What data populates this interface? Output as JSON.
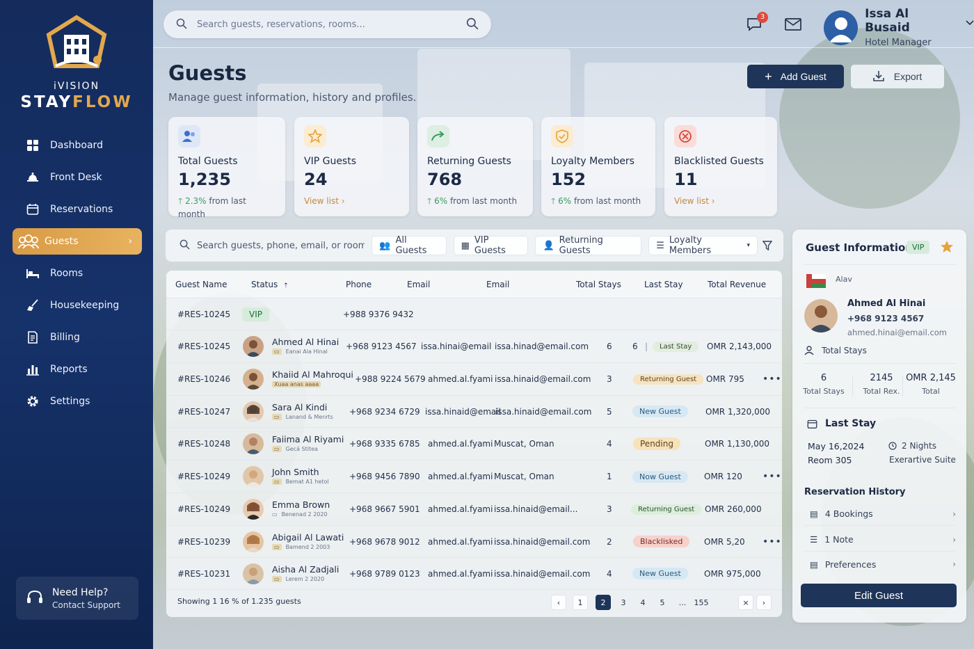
{
  "brand": {
    "line1": "iVISION",
    "line2a": "STAY",
    "line2b": "FLOW"
  },
  "sidebar": {
    "items": [
      {
        "label": "Dashboard",
        "icon": "grid-icon"
      },
      {
        "label": "Front Desk",
        "icon": "bell-icon"
      },
      {
        "label": "Reservations",
        "icon": "calendar-icon"
      },
      {
        "label": "Guests",
        "icon": "users-icon",
        "active": true
      },
      {
        "label": "Rooms",
        "icon": "bed-icon"
      },
      {
        "label": "Housekeeping",
        "icon": "broom-icon"
      },
      {
        "label": "Billing",
        "icon": "invoice-icon"
      },
      {
        "label": "Reports",
        "icon": "bar-chart-icon"
      },
      {
        "label": "Settings",
        "icon": "gear-icon"
      }
    ],
    "help_title": "Need Help?",
    "help_sub": "Contact Support"
  },
  "topbar": {
    "search_placeholder": "Search guests, reservations, rooms...",
    "notif_count": "3",
    "user_name": "Issa Al Busaid",
    "user_role": "Hotel Manager"
  },
  "page": {
    "title": "Guests",
    "subtitle": "Manage guest information, history and profiles.",
    "add_label": "Add Guest",
    "export_label": "Export"
  },
  "cards": [
    {
      "label": "Total Guests",
      "value": "1,235",
      "change": "2.3%",
      "change_text": "from last month",
      "color": "#3b6fd1"
    },
    {
      "label": "VIP Guests",
      "value": "24",
      "link": "View list",
      "color": "#e6a23c"
    },
    {
      "label": "Returning Guests",
      "value": "768",
      "change": "6%",
      "change_text": "from last month",
      "color": "#3a9b5b"
    },
    {
      "label": "Loyalty Members",
      "value": "152",
      "change": "6%",
      "change_text": "from last month",
      "color": "#e6a23c"
    },
    {
      "label": "Blacklisted Guests",
      "value": "11",
      "link": "View list",
      "color": "#d9463a"
    }
  ],
  "filters": {
    "search_placeholder": "Search guests, phone, email, or room #...",
    "chips": [
      "All Guests",
      "VIP Guests",
      "Returning Guests",
      "Loyalty Members"
    ]
  },
  "table": {
    "headers": [
      "Guest Name",
      "Status",
      "Phone",
      "Email",
      "Email",
      "Total Stays",
      "Last Stay",
      "Total Revenue"
    ],
    "rows": [
      {
        "id": "#RES-10245",
        "status": "VIP",
        "phone": "+988 9376 9432"
      },
      {
        "id": "#RES-10245",
        "name": "Ahmed Al Hinai",
        "sub": "Eanai Ala Hinal",
        "phone": "+968 9123 4567",
        "email1": "issa.hinai@email",
        "email2": "issa.hinad@email.com",
        "stays": "6",
        "stays2": "6",
        "status": "Last Stay",
        "revenue": "OMR 2,143,000"
      },
      {
        "id": "#RES-10246",
        "name": "Khaiid Al Mahroqui",
        "sub": "Xuaa anas aaaa",
        "phone": "+988 9224 5679",
        "email1": "ahmed.al.fyami",
        "email2": "issa.hinaid@email.com",
        "stays": "3",
        "status": "Returning Guest",
        "revenue": "OMR 795"
      },
      {
        "id": "#RES-10247",
        "name": "Sara Al Kindi",
        "sub": "Lanand & Menrts",
        "phone": "+968 9234 6729",
        "email1": "issa.hinaid@email",
        "email2": "issa.hinaid@email.com",
        "stays": "5",
        "status": "New Guest",
        "revenue": "OMR 1,320,000"
      },
      {
        "id": "#RES-10248",
        "name": "Faiima Al Riyami",
        "sub": "Gecá Stitea",
        "phone": "+968 9335 6785",
        "email1": "ahmed.al.fyami",
        "email2": "Muscat, Oman",
        "stays": "4",
        "status": "Pending",
        "revenue": "OMR 1,130,000"
      },
      {
        "id": "#RES-10249",
        "name": "John Smith",
        "sub": "Bemat A1 hetol",
        "phone": "+968 9456 7890",
        "email1": "ahmed.al.fyami",
        "email2": "Muscat, Oman",
        "stays": "1",
        "status": "Now Guest",
        "revenue": "OMR 120"
      },
      {
        "id": "#RES-10249",
        "name": "Emma Brown",
        "sub": "Benenad 2 2020",
        "phone": "+968 9667 5901",
        "email1": "ahmed.al.fyami",
        "email2": "issa.hinaid@email...",
        "stays": "3",
        "status": "Returning Guest",
        "revenue": "OMR 260,000"
      },
      {
        "id": "#RES-10239",
        "name": "Abigail Al Lawati",
        "sub": "Bamend 2 2003",
        "phone": "+968 9678 9012",
        "email1": "ahmed.al.fyami",
        "email2": "issa.hinaid@email.com",
        "stays": "2",
        "status": "Blacklisked",
        "revenue": "OMR 5,20"
      },
      {
        "id": "#RES-10231",
        "name": "Aisha Al Zadjali",
        "sub": "Lerem 2 2020",
        "phone": "+968 9789 0123",
        "email1": "ahmed.al.fyami",
        "email2": "issa.hinaid@email.com",
        "stays": "4",
        "status": "New Guest",
        "revenue": "OMR 975,000"
      }
    ],
    "footer": "Showing 1 16 % of 1.235 guests",
    "pages": [
      "1",
      "2",
      "3",
      "4",
      "5",
      "...",
      "155"
    ]
  },
  "panel": {
    "title": "Guest Information",
    "vip": "VIP",
    "flag_label": "Alav",
    "name": "Ahmed Al Hinai",
    "phone": "+968 9123 4567",
    "email": "ahmed.hinai@email.com",
    "stays_label": "Total Stays",
    "stats": [
      {
        "value": "6",
        "label": "Total Stays"
      },
      {
        "value": "2145",
        "label": "Total Rex."
      },
      {
        "value": "OMR 2,145",
        "label": "Total"
      }
    ],
    "last_stay_title": "Last Stay",
    "last_date": "May 16,2024",
    "last_room": "Reom 305",
    "last_nights": "2 Nights",
    "last_suite": "Exerartive Suite",
    "history_title": "Reservation History",
    "links": [
      "4 Bookings",
      "1 Note",
      "Preferences"
    ],
    "edit_label": "Edit Guest"
  }
}
